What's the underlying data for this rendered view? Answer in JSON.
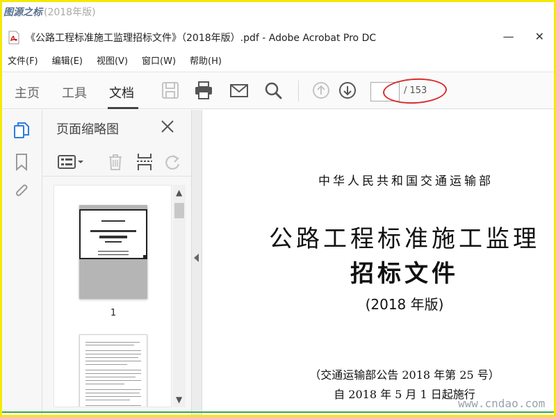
{
  "watermark": {
    "top_site": "图源之标",
    "top_suffix": "(2018年版)",
    "bottom": "www.cndao.com"
  },
  "window": {
    "title": "《公路工程标准施工监理招标文件》（2018年版）.pdf - Adobe Acrobat Pro DC",
    "minimize": "—",
    "close": "✕"
  },
  "menu": {
    "items": [
      {
        "label": "文件(F)"
      },
      {
        "label": "编辑(E)"
      },
      {
        "label": "视图(V)"
      },
      {
        "label": "窗口(W)"
      },
      {
        "label": "帮助(H)"
      }
    ]
  },
  "toolbar": {
    "tabs": {
      "home": "主页",
      "tools": "工具",
      "document": "文档"
    },
    "page_input_value": "",
    "page_total": "/ 153",
    "annotation_color": "#d92b2b"
  },
  "thumbnails_panel": {
    "title": "页面缩略图",
    "page1_label": "1"
  },
  "document": {
    "ministry": "中华人民共和国交通运输部",
    "title_line1": "公路工程标准施工监理",
    "title_line2": "招标文件",
    "edition": "(2018 年版)",
    "notice": "（交通运输部公告 2018 年第 25 号）",
    "effective": "自 2018 年 5 月 1 日起施行"
  },
  "colors": {
    "border": "#f4e900",
    "accent_blue": "#2d7be0",
    "annotation_red": "#d92b2b"
  }
}
